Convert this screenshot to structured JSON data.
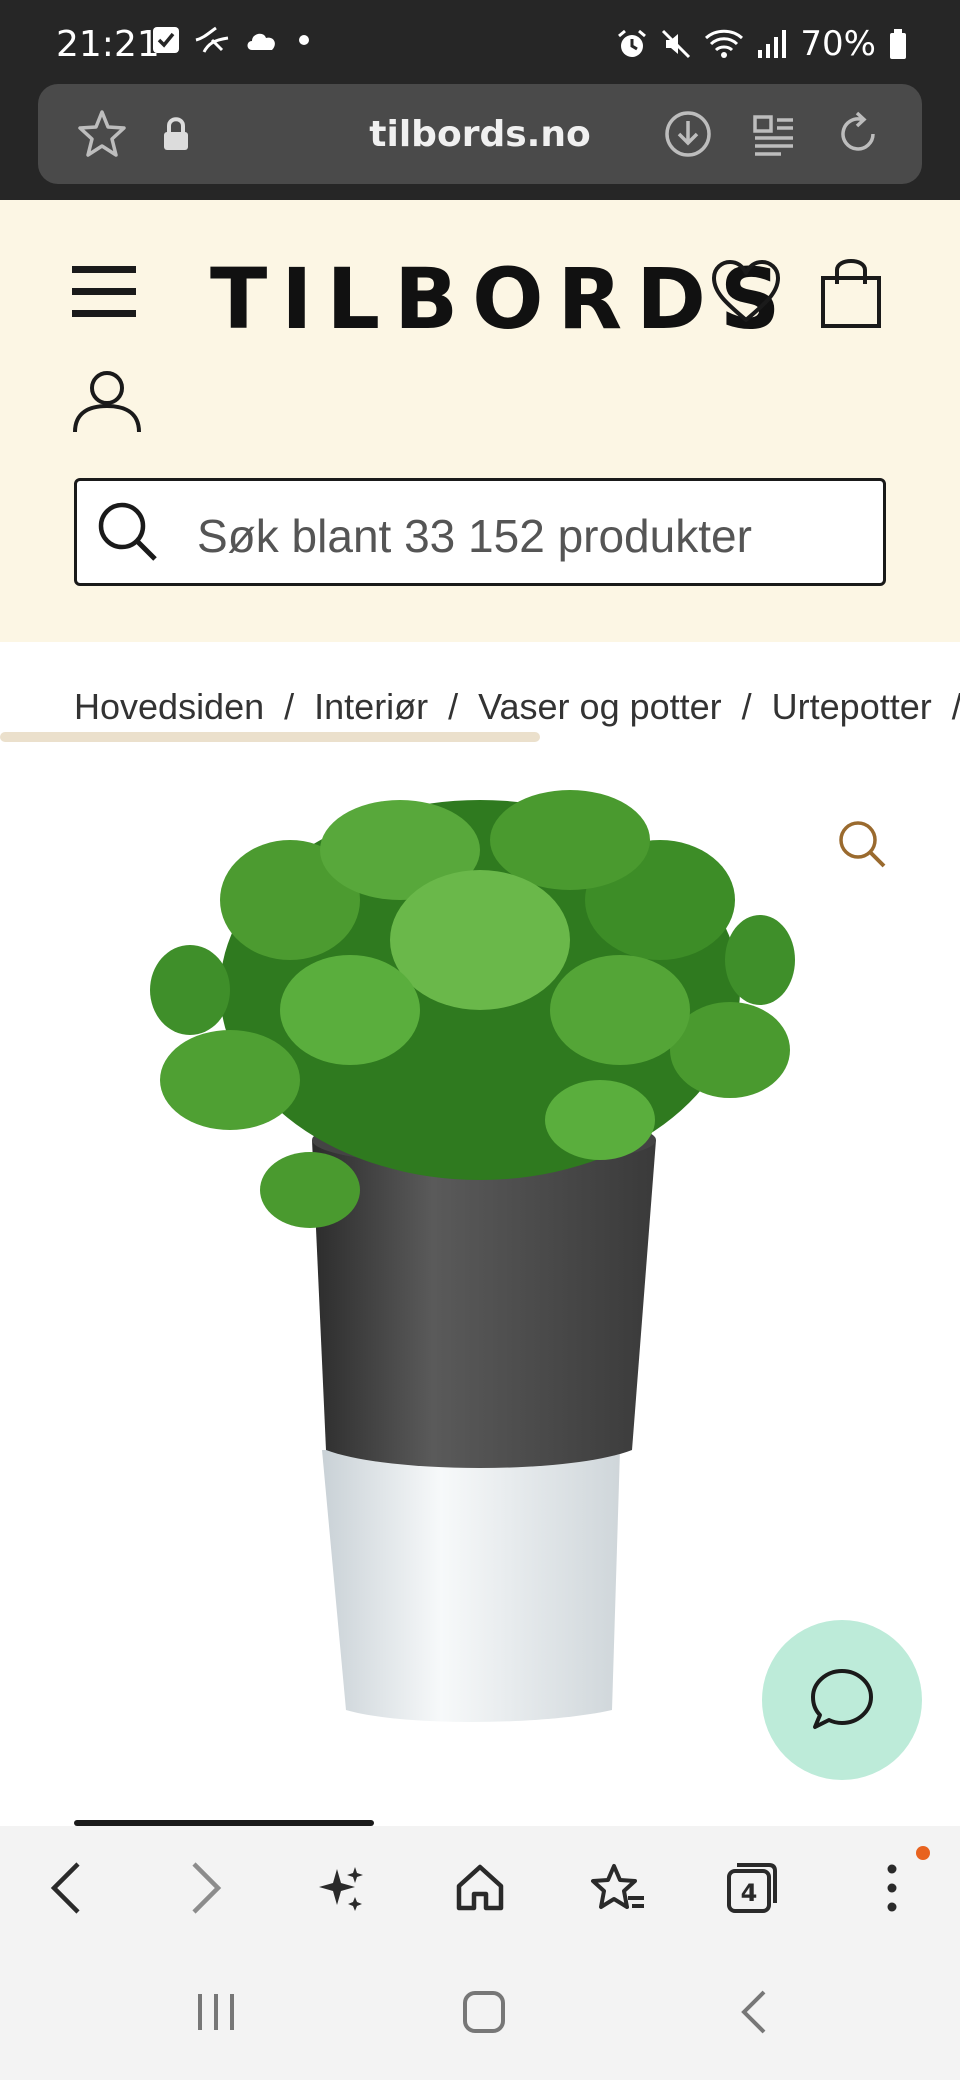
{
  "status_bar": {
    "time": "21:21",
    "battery": "70%",
    "icons": [
      "check-square-icon",
      "bird-icon",
      "cloud-icon",
      "dot-icon",
      "alarm-icon",
      "mute-icon",
      "wifi-icon",
      "signal-icon",
      "battery-icon"
    ]
  },
  "browser": {
    "url": "tilbords.no",
    "tab_count": "4"
  },
  "site": {
    "logo": "TILBORDS",
    "search_placeholder": "Søk blant 33 152 produkter"
  },
  "breadcrumb": [
    "Hovedsiden",
    "Interiør",
    "Vaser og potter",
    "Urtepotter"
  ],
  "colors": {
    "header_bg": "#fcf6e4",
    "chat_bg": "#bdebd9",
    "zoom_icon": "#9a6a2e",
    "notification_dot": "#e8631f"
  }
}
